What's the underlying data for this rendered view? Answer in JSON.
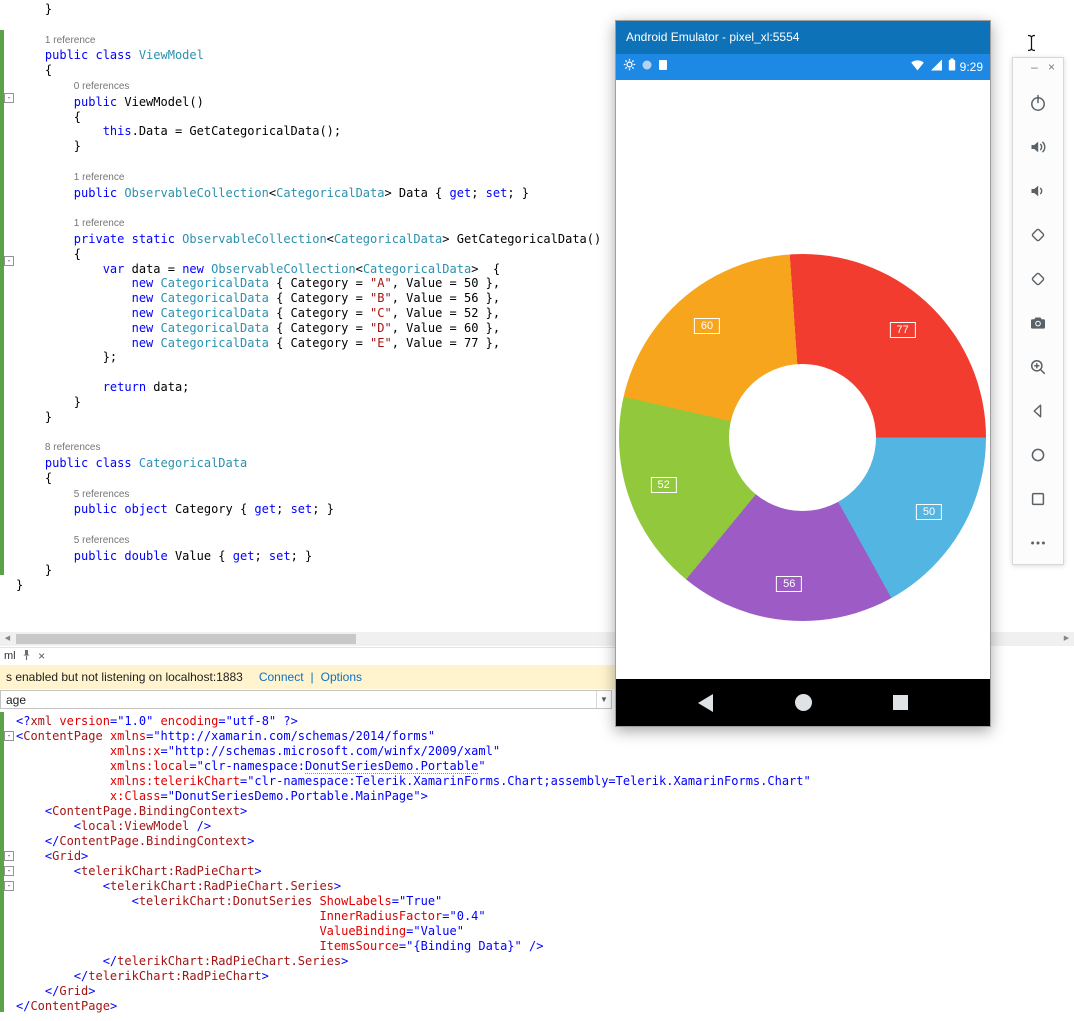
{
  "chart_data": {
    "type": "pie",
    "subtype": "donut",
    "title": "",
    "inner_radius_factor": 0.4,
    "show_labels": true,
    "start_angle_deg": 0,
    "direction": "clockwise",
    "categories": [
      "A",
      "B",
      "C",
      "D",
      "E"
    ],
    "values": [
      50,
      56,
      52,
      60,
      77
    ],
    "colors": [
      "#53B5E2",
      "#9D5BC5",
      "#92C83C",
      "#F8A51E",
      "#F23C30"
    ],
    "label_color": "#ffffff"
  },
  "emulator": {
    "title": "Android Emulator - pixel_xl:5554",
    "time": "9:29"
  },
  "toolbar": {
    "minimize": "–",
    "close": "×",
    "buttons": [
      "power",
      "volume-up",
      "volume-down",
      "rotate-left",
      "rotate-right",
      "screenshot",
      "zoom",
      "back",
      "home",
      "overview",
      "more"
    ]
  },
  "ui": {
    "tab": {
      "label": "ml"
    },
    "infobar": {
      "message": "s enabled but not listening on localhost:1883",
      "connect": "Connect",
      "separator": "|",
      "options": "Options"
    },
    "combo": {
      "value": "age"
    },
    "scroll": {
      "left_arrow": "◀",
      "right_arrow": "▶"
    }
  },
  "top_editor": {
    "fold_lines": [
      6,
      17
    ],
    "lines": [
      {
        "s": [
          [
            "    }",
            "p"
          ]
        ]
      },
      {
        "s": []
      },
      {
        "s": [
          [
            "    ",
            ""
          ],
          [
            "1 reference",
            "r"
          ]
        ]
      },
      {
        "s": [
          [
            "    ",
            ""
          ],
          [
            "public class ",
            "k"
          ],
          [
            "ViewModel",
            "t"
          ]
        ]
      },
      {
        "s": [
          [
            "    {",
            "p"
          ]
        ]
      },
      {
        "s": [
          [
            "        ",
            ""
          ],
          [
            "0 references",
            "r"
          ]
        ]
      },
      {
        "s": [
          [
            "        ",
            ""
          ],
          [
            "public ",
            "k"
          ],
          [
            "ViewModel()",
            "p"
          ]
        ]
      },
      {
        "s": [
          [
            "        {",
            "p"
          ]
        ]
      },
      {
        "s": [
          [
            "            ",
            ""
          ],
          [
            "this",
            "k"
          ],
          [
            ".Data = GetCategoricalData();",
            "p"
          ]
        ]
      },
      {
        "s": [
          [
            "        }",
            "p"
          ]
        ]
      },
      {
        "s": []
      },
      {
        "s": [
          [
            "        ",
            ""
          ],
          [
            "1 reference",
            "r"
          ]
        ]
      },
      {
        "s": [
          [
            "        ",
            ""
          ],
          [
            "public ",
            "k"
          ],
          [
            "ObservableCollection",
            "t"
          ],
          [
            "<",
            "p"
          ],
          [
            "CategoricalData",
            "t"
          ],
          [
            "> Data { ",
            "p"
          ],
          [
            "get",
            "k"
          ],
          [
            "; ",
            "p"
          ],
          [
            "set",
            "k"
          ],
          [
            "; }",
            "p"
          ]
        ]
      },
      {
        "s": []
      },
      {
        "s": [
          [
            "        ",
            ""
          ],
          [
            "1 reference",
            "r"
          ]
        ]
      },
      {
        "s": [
          [
            "        ",
            ""
          ],
          [
            "private static ",
            "k"
          ],
          [
            "ObservableCollection",
            "t"
          ],
          [
            "<",
            "p"
          ],
          [
            "CategoricalData",
            "t"
          ],
          [
            "> GetCategoricalData()",
            "p"
          ]
        ]
      },
      {
        "s": [
          [
            "        {",
            "p"
          ]
        ]
      },
      {
        "s": [
          [
            "            ",
            ""
          ],
          [
            "var",
            "k"
          ],
          [
            " data = ",
            "p"
          ],
          [
            "new ",
            "k"
          ],
          [
            "ObservableCollection",
            "t"
          ],
          [
            "<",
            "p"
          ],
          [
            "CategoricalData",
            "t"
          ],
          [
            ">  {",
            "p"
          ]
        ]
      },
      {
        "s": [
          [
            "                ",
            ""
          ],
          [
            "new ",
            "k"
          ],
          [
            "CategoricalData",
            "t"
          ],
          [
            " { Category = ",
            "p"
          ],
          [
            "\"A\"",
            "s"
          ],
          [
            ", Value = 50 },",
            "p"
          ]
        ]
      },
      {
        "s": [
          [
            "                ",
            ""
          ],
          [
            "new ",
            "k"
          ],
          [
            "CategoricalData",
            "t"
          ],
          [
            " { Category = ",
            "p"
          ],
          [
            "\"B\"",
            "s"
          ],
          [
            ", Value = 56 },",
            "p"
          ]
        ]
      },
      {
        "s": [
          [
            "                ",
            ""
          ],
          [
            "new ",
            "k"
          ],
          [
            "CategoricalData",
            "t"
          ],
          [
            " { Category = ",
            "p"
          ],
          [
            "\"C\"",
            "s"
          ],
          [
            ", Value = 52 },",
            "p"
          ]
        ]
      },
      {
        "s": [
          [
            "                ",
            ""
          ],
          [
            "new ",
            "k"
          ],
          [
            "CategoricalData",
            "t"
          ],
          [
            " { Category = ",
            "p"
          ],
          [
            "\"D\"",
            "s"
          ],
          [
            ", Value = 60 },",
            "p"
          ]
        ]
      },
      {
        "s": [
          [
            "                ",
            ""
          ],
          [
            "new ",
            "k"
          ],
          [
            "CategoricalData",
            "t"
          ],
          [
            " { Category = ",
            "p"
          ],
          [
            "\"E\"",
            "s"
          ],
          [
            ", Value = 77 },",
            "p"
          ]
        ]
      },
      {
        "s": [
          [
            "            };",
            "p"
          ]
        ]
      },
      {
        "s": []
      },
      {
        "s": [
          [
            "            ",
            ""
          ],
          [
            "return",
            "k"
          ],
          [
            " data;",
            "p"
          ]
        ]
      },
      {
        "s": [
          [
            "        }",
            "p"
          ]
        ]
      },
      {
        "s": [
          [
            "    }",
            "p"
          ]
        ]
      },
      {
        "s": []
      },
      {
        "s": [
          [
            "    ",
            ""
          ],
          [
            "8 references",
            "r"
          ]
        ]
      },
      {
        "s": [
          [
            "    ",
            ""
          ],
          [
            "public class ",
            "k"
          ],
          [
            "CategoricalData",
            "t"
          ]
        ]
      },
      {
        "s": [
          [
            "    {",
            "p"
          ]
        ]
      },
      {
        "s": [
          [
            "        ",
            ""
          ],
          [
            "5 references",
            "r"
          ]
        ]
      },
      {
        "s": [
          [
            "        ",
            ""
          ],
          [
            "public object",
            "k"
          ],
          [
            " Category { ",
            "p"
          ],
          [
            "get",
            "k"
          ],
          [
            "; ",
            "p"
          ],
          [
            "set",
            "k"
          ],
          [
            "; }",
            "p"
          ]
        ]
      },
      {
        "s": []
      },
      {
        "s": [
          [
            "        ",
            ""
          ],
          [
            "5 references",
            "r"
          ]
        ]
      },
      {
        "s": [
          [
            "        ",
            ""
          ],
          [
            "public double",
            "k"
          ],
          [
            " Value { ",
            "p"
          ],
          [
            "get",
            "k"
          ],
          [
            "; ",
            "p"
          ],
          [
            "set",
            "k"
          ],
          [
            "; }",
            "p"
          ]
        ]
      },
      {
        "s": [
          [
            "    }",
            "p"
          ]
        ]
      },
      {
        "s": [
          [
            "}",
            "p"
          ]
        ]
      }
    ]
  },
  "xaml_editor": {
    "fold_lines": [
      1,
      9,
      10,
      11
    ],
    "lines": [
      {
        "s": [
          [
            "<?",
            "d"
          ],
          [
            "xml",
            "e"
          ],
          [
            " ",
            "p"
          ],
          [
            "version",
            "a"
          ],
          [
            "=",
            "d"
          ],
          [
            "\"1.0\"",
            "v"
          ],
          [
            " ",
            "p"
          ],
          [
            "encoding",
            "a"
          ],
          [
            "=",
            "d"
          ],
          [
            "\"utf-8\"",
            "v"
          ],
          [
            " ",
            "p"
          ],
          [
            "?>",
            "d"
          ]
        ]
      },
      {
        "s": [
          [
            "<",
            "d"
          ],
          [
            "ContentPage",
            "e"
          ],
          [
            " ",
            "p"
          ],
          [
            "xmlns",
            "a"
          ],
          [
            "=",
            "d"
          ],
          [
            "\"http://xamarin.com/schemas/2014/forms\"",
            "v"
          ]
        ]
      },
      {
        "s": [
          [
            "             ",
            ""
          ],
          [
            "xmlns:x",
            "a"
          ],
          [
            "=",
            "d"
          ],
          [
            "\"http://schemas.microsoft.com/winfx/2009/xaml\"",
            "v"
          ]
        ]
      },
      {
        "s": [
          [
            "             ",
            ""
          ],
          [
            "xmlns:local",
            "a"
          ],
          [
            "=",
            "d"
          ],
          [
            "\"clr-namespace:",
            "v"
          ],
          [
            "DonutSeriesDemo.Portable",
            "vu"
          ],
          [
            "\"",
            "v"
          ]
        ]
      },
      {
        "s": [
          [
            "             ",
            ""
          ],
          [
            "xmlns:telerikChart",
            "a"
          ],
          [
            "=",
            "d"
          ],
          [
            "\"clr-namespace:Telerik.XamarinForms.Chart;assembly=Telerik.XamarinForms.Chart\"",
            "v"
          ]
        ]
      },
      {
        "s": [
          [
            "             ",
            ""
          ],
          [
            "x:Class",
            "a"
          ],
          [
            "=",
            "d"
          ],
          [
            "\"DonutSeriesDemo.Portable.MainPage\"",
            "v"
          ],
          [
            ">",
            "d"
          ]
        ]
      },
      {
        "s": [
          [
            "    ",
            ""
          ],
          [
            "<",
            "d"
          ],
          [
            "ContentPage.BindingContext",
            "e"
          ],
          [
            ">",
            "d"
          ]
        ]
      },
      {
        "s": [
          [
            "        ",
            ""
          ],
          [
            "<",
            "d"
          ],
          [
            "local:ViewModel",
            "e"
          ],
          [
            " ",
            "p"
          ],
          [
            "/>",
            "d"
          ]
        ]
      },
      {
        "s": [
          [
            "    ",
            ""
          ],
          [
            "</",
            "d"
          ],
          [
            "ContentPage.BindingContext",
            "e"
          ],
          [
            ">",
            "d"
          ]
        ]
      },
      {
        "s": [
          [
            "    ",
            ""
          ],
          [
            "<",
            "d"
          ],
          [
            "Grid",
            "e"
          ],
          [
            ">",
            "d"
          ]
        ]
      },
      {
        "s": [
          [
            "        ",
            ""
          ],
          [
            "<",
            "d"
          ],
          [
            "telerikChart:RadPieChart",
            "e"
          ],
          [
            ">",
            "d"
          ]
        ]
      },
      {
        "s": [
          [
            "            ",
            ""
          ],
          [
            "<",
            "d"
          ],
          [
            "telerikChart:RadPieChart.Series",
            "e"
          ],
          [
            ">",
            "d"
          ]
        ]
      },
      {
        "s": [
          [
            "                ",
            ""
          ],
          [
            "<",
            "d"
          ],
          [
            "telerikChart:DonutSeries",
            "e"
          ],
          [
            " ",
            "p"
          ],
          [
            "ShowLabels",
            "a"
          ],
          [
            "=",
            "d"
          ],
          [
            "\"True\"",
            "v"
          ]
        ]
      },
      {
        "s": [
          [
            "                                          ",
            ""
          ],
          [
            "InnerRadiusFactor",
            "a"
          ],
          [
            "=",
            "d"
          ],
          [
            "\"0.4\"",
            "v"
          ]
        ]
      },
      {
        "s": [
          [
            "                                          ",
            ""
          ],
          [
            "ValueBinding",
            "a"
          ],
          [
            "=",
            "d"
          ],
          [
            "\"Value\"",
            "v"
          ]
        ]
      },
      {
        "s": [
          [
            "                                          ",
            ""
          ],
          [
            "ItemsSource",
            "a"
          ],
          [
            "=",
            "d"
          ],
          [
            "\"{Binding Data}\"",
            "v"
          ],
          [
            " ",
            "p"
          ],
          [
            "/>",
            "d"
          ]
        ]
      },
      {
        "s": [
          [
            "            ",
            ""
          ],
          [
            "</",
            "d"
          ],
          [
            "telerikChart:RadPieChart.Series",
            "e"
          ],
          [
            ">",
            "d"
          ]
        ]
      },
      {
        "s": [
          [
            "        ",
            ""
          ],
          [
            "</",
            "d"
          ],
          [
            "telerikChart:RadPieChart",
            "e"
          ],
          [
            ">",
            "d"
          ]
        ]
      },
      {
        "s": [
          [
            "    ",
            ""
          ],
          [
            "</",
            "d"
          ],
          [
            "Grid",
            "e"
          ],
          [
            ">",
            "d"
          ]
        ]
      },
      {
        "s": [
          [
            "</",
            "d"
          ],
          [
            "ContentPage",
            "e"
          ],
          [
            ">",
            "d"
          ]
        ]
      }
    ]
  }
}
